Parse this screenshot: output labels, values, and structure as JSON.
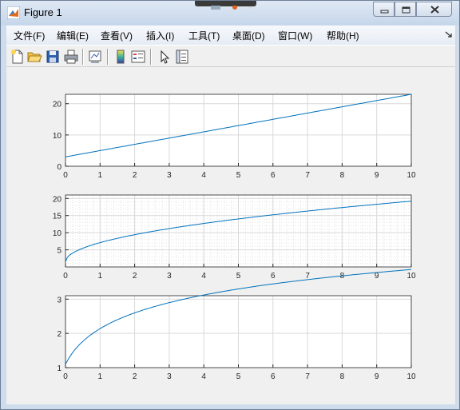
{
  "window": {
    "title": "Figure 1",
    "buttons": {
      "minimize": "minimize",
      "maximize": "maximize",
      "close": "close"
    }
  },
  "menu": [
    {
      "label": "文件(F)"
    },
    {
      "label": "编辑(E)"
    },
    {
      "label": "查看(V)"
    },
    {
      "label": "插入(I)"
    },
    {
      "label": "工具(T)"
    },
    {
      "label": "桌面(D)"
    },
    {
      "label": "窗口(W)"
    },
    {
      "label": "帮助(H)"
    }
  ],
  "toolbar": [
    {
      "icon": "new-figure-icon"
    },
    {
      "icon": "open-folder-icon"
    },
    {
      "icon": "save-icon"
    },
    {
      "icon": "print-icon"
    },
    {
      "icon": "link-plot-icon"
    },
    {
      "icon": "colorbar-icon"
    },
    {
      "icon": "legend-icon"
    },
    {
      "icon": "pointer-icon"
    },
    {
      "icon": "property-editor-icon"
    }
  ],
  "colors": {
    "line": "#0072bd",
    "grid": "#d9d9d9",
    "axes": "#262626"
  },
  "chart_data": [
    {
      "type": "line",
      "function": "linear",
      "x": [
        0,
        10
      ],
      "y": [
        3,
        23
      ],
      "xlim": [
        0,
        10
      ],
      "ylim": [
        0,
        23
      ],
      "xticks": [
        "0",
        "1",
        "2",
        "3",
        "4",
        "5",
        "6",
        "7",
        "8",
        "9",
        "10"
      ],
      "yticks": [
        "0",
        "10",
        "20"
      ],
      "grid": true,
      "minor_grid": false
    },
    {
      "type": "line",
      "function": "sqrt",
      "x": [
        0,
        0.5,
        1,
        2,
        3,
        4,
        5,
        6,
        7,
        8,
        9,
        10
      ],
      "y": [
        1.5,
        4.5,
        6,
        8.5,
        10.4,
        12,
        13.4,
        14.7,
        15.9,
        17,
        18,
        19
      ],
      "xlim": [
        0,
        10
      ],
      "ylim": [
        0,
        21
      ],
      "xticks": [
        "0",
        "1",
        "2",
        "3",
        "4",
        "5",
        "6",
        "7",
        "8",
        "9",
        "10"
      ],
      "yticks": [
        "5",
        "10",
        "15",
        "20"
      ],
      "grid": true,
      "minor_grid": true
    },
    {
      "type": "line",
      "function": "log",
      "x": [
        0,
        1,
        2,
        3,
        4,
        5,
        6,
        7,
        8,
        9,
        10
      ],
      "y": [
        1.1,
        1.65,
        1.95,
        2.2,
        2.4,
        2.55,
        2.7,
        2.82,
        2.93,
        3.02,
        3.1
      ],
      "xlim": [
        0,
        10
      ],
      "ylim": [
        1,
        3.1
      ],
      "xticks": [
        "0",
        "1",
        "2",
        "3",
        "4",
        "5",
        "6",
        "7",
        "8",
        "9",
        "10"
      ],
      "yticks": [
        "1",
        "2",
        "3"
      ],
      "grid": true,
      "minor_grid": false
    }
  ]
}
